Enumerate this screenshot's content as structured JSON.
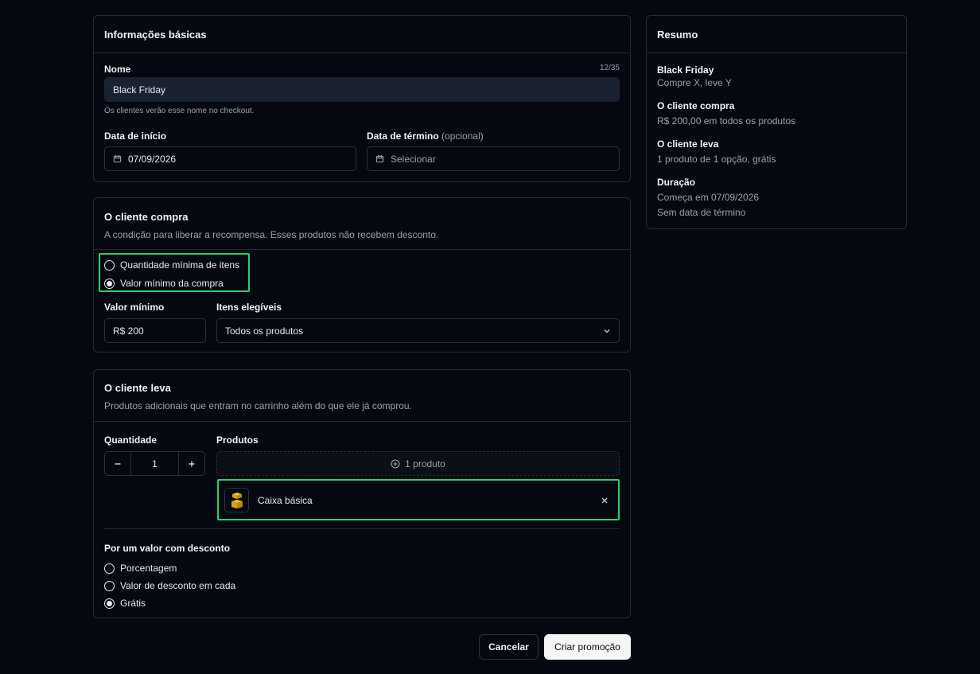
{
  "basic": {
    "title": "Informações básicas",
    "name_label": "Nome",
    "name_counter": "12/35",
    "name_value": "Black Friday",
    "name_hint": "Os clientes verão esse nome no checkout.",
    "start_label": "Data de início",
    "start_value": "07/09/2026",
    "end_label": "Data de término",
    "end_optional": "(opcional)",
    "end_placeholder": "Selecionar"
  },
  "buys": {
    "title": "O cliente compra",
    "description": "A condição para liberar a recompensa. Esses produtos não recebem desconto.",
    "options": [
      {
        "label": "Quantidade mínima de itens",
        "selected": false
      },
      {
        "label": "Valor mínimo da compra",
        "selected": true
      }
    ],
    "min_value_label": "Valor mínimo",
    "min_value": "R$ 200",
    "eligible_label": "Itens elegíveis",
    "eligible_value": "Todos os produtos"
  },
  "gets": {
    "title": "O cliente leva",
    "description": "Produtos adicionais que entram no carrinho além do que ele já comprou.",
    "quantity_label": "Quantidade",
    "quantity_value": "1",
    "products_label": "Produtos",
    "add_product_label": "1 produto",
    "product_name": "Caixa básica",
    "discount_label": "Por um valor com desconto",
    "discount_options": [
      {
        "label": "Porcentagem",
        "selected": false
      },
      {
        "label": "Valor de desconto em cada",
        "selected": false
      },
      {
        "label": "Grátis",
        "selected": true
      }
    ]
  },
  "summary": {
    "title": "Resumo",
    "promo_name": "Black Friday",
    "promo_type": "Compre X, leve Y",
    "buys_title": "O cliente compra",
    "buys_text": "R$ 200,00 em todos os produtos",
    "gets_title": "O cliente leva",
    "gets_text": "1 produto de 1 opção, grátis",
    "duration_title": "Duração",
    "duration_start": "Começa em 07/09/2026",
    "duration_end": "Sem data de término"
  },
  "actions": {
    "cancel": "Cancelar",
    "create": "Criar promoção"
  },
  "icons": {
    "calendar": "calendar-icon",
    "chevron": "chevron-down-icon",
    "plus_circle": "plus-circle-icon",
    "close": "close-icon",
    "product": "gift-box-icon"
  },
  "colors": {
    "background": "#050810",
    "highlight": "#22d36b",
    "input_filled": "#1a2231"
  }
}
